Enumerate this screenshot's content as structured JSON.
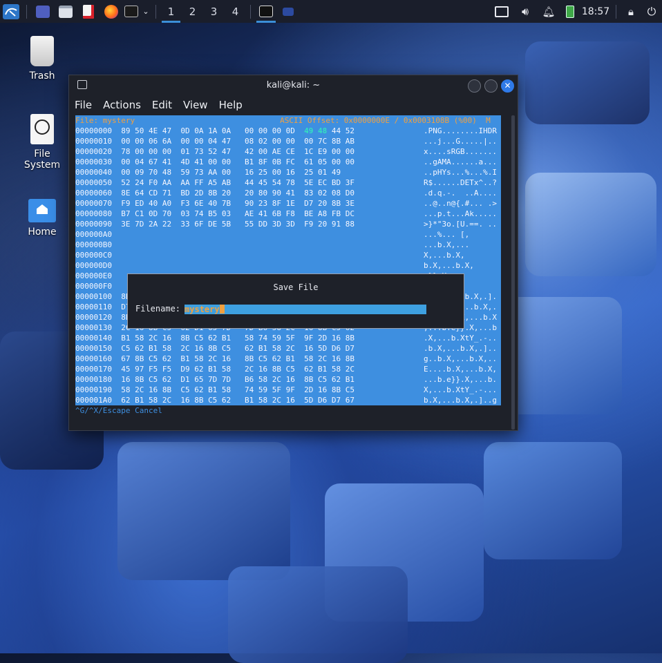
{
  "panel": {
    "workspaces": [
      "1",
      "2",
      "3",
      "4"
    ],
    "active_workspace": "1",
    "clock": "18:57",
    "icons": [
      "kali-menu-icon",
      "desktop-icon",
      "files-icon",
      "text-editor-icon",
      "firefox-icon",
      "terminal-icon",
      "chevron-down-icon",
      "terminal-task-icon",
      "window-task-icon",
      "display-icon",
      "volume-icon",
      "notifications-icon",
      "battery-icon",
      "lock-icon",
      "logout-icon"
    ]
  },
  "desktop": {
    "items": [
      {
        "label": "Trash",
        "icon": "trash-icon"
      },
      {
        "label": "File System",
        "icon": "drive-icon"
      },
      {
        "label": "Home",
        "icon": "home-folder-icon"
      }
    ]
  },
  "window": {
    "title": "kali@kali: ~",
    "menu": [
      "File",
      "Actions",
      "Edit",
      "View",
      "Help"
    ]
  },
  "hexeditor": {
    "header_left": "File: mystery",
    "header_right": "ASCII Offset: 0x0000000E / 0x0003108B (%00)  M",
    "rows": [
      {
        "off": "00000000",
        "hex": "89 50 4E 47  0D 0A 1A 0A   00 00 00 0D  ",
        "hl": "49 48",
        "hex2": " 44 52",
        "ascii": ".PNG........IHDR"
      },
      {
        "off": "00000010",
        "hex": "00 00 06 6A  00 00 04 47   08 02 00 00  00 7C 8B AB",
        "hl": "",
        "hex2": "",
        "ascii": "...j...G.....|.."
      },
      {
        "off": "00000020",
        "hex": "78 00 00 00  01 73 52 47   42 00 AE CE  1C E9 00 00",
        "hl": "",
        "hex2": "",
        "ascii": "x....sRGB......."
      },
      {
        "off": "00000030",
        "hex": "00 04 67 41  4D 41 00 00   B1 8F 0B FC  61 05 00 00",
        "hl": "",
        "hex2": "",
        "ascii": "..gAMA......a..."
      },
      {
        "off": "00000040",
        "hex": "00 09 70 48  59 73 AA 00   16 25 00 16  25 01 49",
        "hl": "",
        "hex2": "",
        "ascii": "..pHYs...%...%.I"
      },
      {
        "off": "00000050",
        "hex": "52 24 F0 AA  AA FF A5 AB   44 45 54 78  5E EC BD 3F",
        "hl": "",
        "hex2": "",
        "ascii": "R$......DETx^..?"
      },
      {
        "off": "00000060",
        "hex": "8E 64 CD 71  BD 2D 8B 20   20 80 90 41  83 02 08 D0",
        "hl": "",
        "hex2": "",
        "ascii": ".d.q.-.  ..A...."
      },
      {
        "off": "00000070",
        "hex": "F9 ED 40 A0  F3 6E 40 7B   90 23 8F 1E  D7 20 8B 3E",
        "hl": "",
        "hex2": "",
        "ascii": "..@..n@{.#... .>"
      },
      {
        "off": "00000080",
        "hex": "B7 C1 0D 70  03 74 B5 03   AE 41 6B F8  BE A8 FB DC",
        "hl": "",
        "hex2": "",
        "ascii": "...p.t...Ak....."
      },
      {
        "off": "00000090",
        "hex": "3E 7D 2A 22  33 6F DE 5B   55 DD 3D 3D  F9 20 91 88",
        "hl": "",
        "hex2": "",
        "ascii": ">}*\"3o.[U.==. .."
      },
      {
        "off": "000000A0",
        "hex": "",
        "hl": "",
        "hex2": "",
        "ascii": "...%... [,"
      },
      {
        "off": "000000B0",
        "hex": "",
        "hl": "",
        "hex2": "",
        "ascii": "...b.X,..."
      },
      {
        "off": "000000C0",
        "hex": "",
        "hl": "",
        "hex2": "",
        "ascii": "X,...b.X,"
      },
      {
        "off": "000000D0",
        "hex": "",
        "hl": "",
        "hex2": "",
        "ascii": "b.X,...b.X,"
      },
      {
        "off": "000000E0",
        "hex": "",
        "hl": "",
        "hex2": "",
        "ascii": "e}}.X,..."
      },
      {
        "off": "000000F0",
        "hex": "",
        "hl": "",
        "hex2": "",
        "ascii": "b.XtY_.-."
      },
      {
        "off": "00000100",
        "hex": "8B C5 62 B1  58 2C 16 8B   C5 62 B1 58  2C 16 5D D6",
        "hl": "",
        "hex2": "",
        "ascii": "..b.X,...b.X,.]."
      },
      {
        "off": "00000110",
        "hex": "D7 67 8B C5  62 B1 58 2C   16 8B C5 62  B1 58 2C 16",
        "hl": "",
        "hex2": "",
        "ascii": ".g..b.X,...b.X,."
      },
      {
        "off": "00000120",
        "hex": "8B 45 97 F5  F5 D9 62 B1   58 2C 16 8B  C5 62 B1 58",
        "hl": "",
        "hex2": "",
        "ascii": ".E....b.X,...b.X"
      },
      {
        "off": "00000130",
        "hex": "2C 16 8B C5  62 D1 65 7D   7D B6 58 2C  16 8B C5 62",
        "hl": "",
        "hex2": "",
        "ascii": ",...b.e}}.X,...b"
      },
      {
        "off": "00000140",
        "hex": "B1 58 2C 16  8B C5 62 B1   58 74 59 5F  9F 2D 16 8B",
        "hl": "",
        "hex2": "",
        "ascii": ".X,...b.XtY_.-.."
      },
      {
        "off": "00000150",
        "hex": "C5 62 B1 58  2C 16 8B C5   62 B1 58 2C  16 5D D6 D7",
        "hl": "",
        "hex2": "",
        "ascii": ".b.X,...b.X,.].."
      },
      {
        "off": "00000160",
        "hex": "67 8B C5 62  B1 58 2C 16   8B C5 62 B1  58 2C 16 8B",
        "hl": "",
        "hex2": "",
        "ascii": "g..b.X,...b.X,.."
      },
      {
        "off": "00000170",
        "hex": "45 97 F5 F5  D9 62 B1 58   2C 16 8B C5  62 B1 58 2C",
        "hl": "",
        "hex2": "",
        "ascii": "E....b.X,...b.X,"
      },
      {
        "off": "00000180",
        "hex": "16 8B C5 62  D1 65 7D 7D   B6 58 2C 16  8B C5 62 B1",
        "hl": "",
        "hex2": "",
        "ascii": "...b.e}}.X,...b."
      },
      {
        "off": "00000190",
        "hex": "58 2C 16 8B  C5 62 B1 58   74 59 5F 9F  2D 16 8B C5",
        "hl": "",
        "hex2": "",
        "ascii": "X,...b.XtY_.-..."
      },
      {
        "off": "000001A0",
        "hex": "62 B1 58 2C  16 8B C5 62   B1 58 2C 16  5D D6 D7 67",
        "hl": "",
        "hex2": "",
        "ascii": "b.X,...b.X,.]..g"
      }
    ],
    "footer": "^G/^X/Escape Cancel"
  },
  "dialog": {
    "title": "Save File",
    "label": "Filename:",
    "value": "mystery"
  }
}
